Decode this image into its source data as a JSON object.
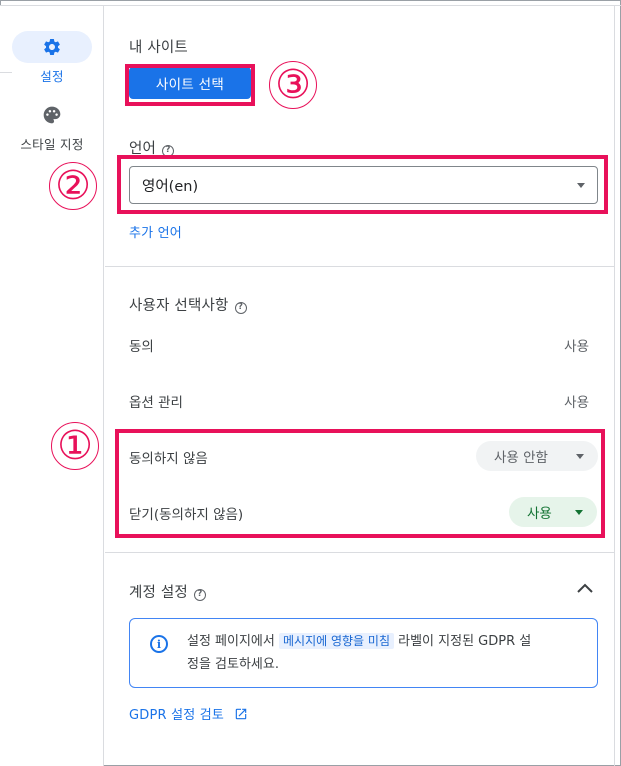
{
  "rail": {
    "items": [
      {
        "label": "설정",
        "icon": "gear-icon",
        "active": true
      },
      {
        "label": "스타일 지정",
        "icon": "palette-icon",
        "active": false
      }
    ]
  },
  "site": {
    "heading": "내 사이트",
    "select_button": "사이트 선택"
  },
  "language": {
    "heading": "언어",
    "help": "?",
    "selected": "영어(en)",
    "add_link": "추가 언어"
  },
  "preferences": {
    "heading": "사용자 선택사항",
    "help": "?",
    "rows": [
      {
        "label": "동의",
        "value": "사용"
      },
      {
        "label": "옵션 관리",
        "value": "사용"
      },
      {
        "label": "동의하지 않음",
        "value": "사용 안함"
      },
      {
        "label": "닫기(동의하지 않음)",
        "value": "사용"
      }
    ]
  },
  "account": {
    "heading": "계정 설정",
    "help": "?",
    "info_icon": "i",
    "info_text_1": "설정 페이지에서",
    "info_highlight": "메시지에 영향을 미침",
    "info_text_2": "라벨이 지정된 GDPR 설",
    "info_text_3": "정을 검토하세요.",
    "review_link": "GDPR 설정 검토"
  },
  "annotations": [
    "①",
    "②",
    "③"
  ],
  "colors": {
    "accent": "#1a73e8",
    "annotation": "#e8115a",
    "enabled_chip_bg": "#e6f4ea",
    "enabled_chip_text": "#137333",
    "disabled_chip_bg": "#f1f3f4"
  }
}
